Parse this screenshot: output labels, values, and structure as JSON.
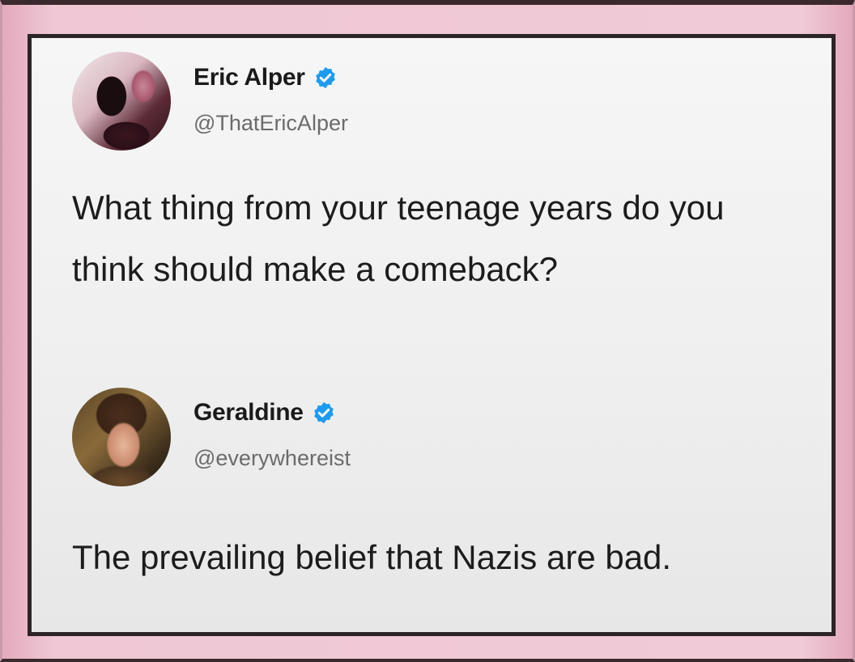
{
  "tweets": [
    {
      "display_name": "Eric Alper",
      "handle": "@ThatEricAlper",
      "text": "What thing from your teenage years do you think should make a comeback?",
      "verified_color": "#1d9bf0"
    },
    {
      "display_name": "Geraldine",
      "handle": "@everywhereist",
      "text": "The prevailing belief that Nazis are bad.",
      "verified_color": "#1d9bf0"
    }
  ],
  "icons": {
    "verified": "verified-badge-icon",
    "avatar": "profile-avatar"
  },
  "colors": {
    "frame_background": "#e9bccc",
    "card_border": "#2c2426",
    "card_background": "#f2f2f2"
  }
}
